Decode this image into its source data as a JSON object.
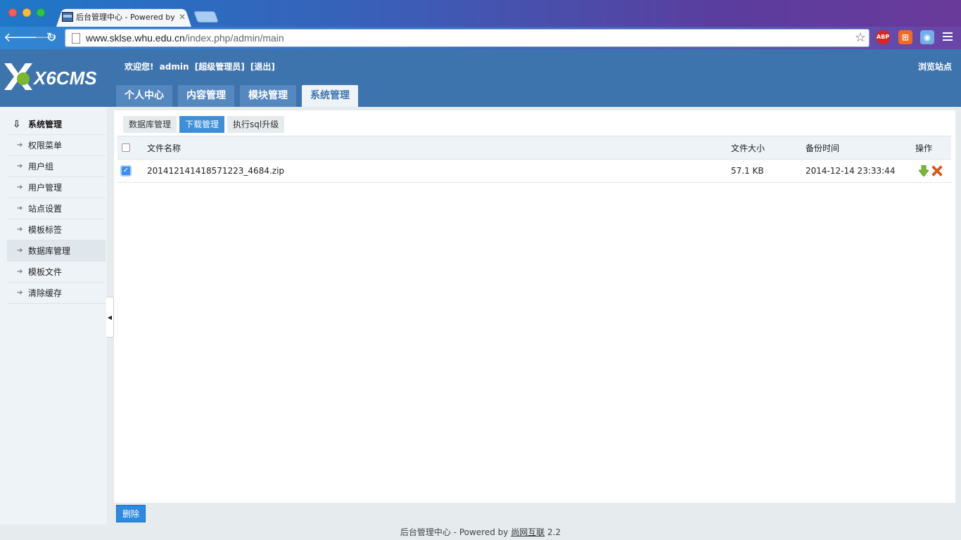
{
  "browser": {
    "tab_title": "后台管理中心 - Powered by",
    "tab_close": "✕",
    "url_host": "www.sklse.whu.edu.cn",
    "url_path": "/index.php/admin/main",
    "ext_abp": "ABP"
  },
  "header": {
    "logo_text": "X6CMS",
    "welcome_prefix": "欢迎您!",
    "username": "admin",
    "role": "[超级管理员]",
    "logout": "[退出]",
    "view_site": "浏览站点",
    "tabs": [
      {
        "label": "个人中心"
      },
      {
        "label": "内容管理"
      },
      {
        "label": "模块管理"
      },
      {
        "label": "系统管理"
      }
    ]
  },
  "sidebar": {
    "title": "系统管理",
    "items": [
      {
        "label": "权限菜单"
      },
      {
        "label": "用户组"
      },
      {
        "label": "用户管理"
      },
      {
        "label": "站点设置"
      },
      {
        "label": "模板标签"
      },
      {
        "label": "数据库管理"
      },
      {
        "label": "模板文件"
      },
      {
        "label": "清除缓存"
      }
    ],
    "collapse_glyph": "◀"
  },
  "content": {
    "sub_tabs": [
      {
        "label": "数据库管理"
      },
      {
        "label": "下载管理"
      },
      {
        "label": "执行sql升级"
      }
    ],
    "columns": {
      "name": "文件名称",
      "size": "文件大小",
      "time": "备份时间",
      "op": "操作"
    },
    "rows": [
      {
        "name": "201412141418571223_4684.zip",
        "size": "57.1 KB",
        "time": "2014-12-14 23:33:44",
        "checked": true
      }
    ]
  },
  "actions": {
    "delete_label": "删除"
  },
  "footer": {
    "prefix": "后台管理中心 - Powered by",
    "link": "尚网互联",
    "version": "2.2"
  }
}
